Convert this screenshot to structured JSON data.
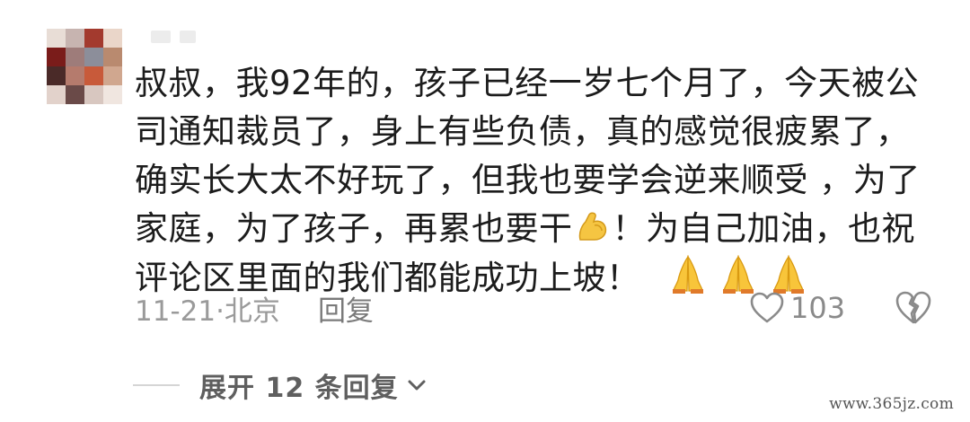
{
  "comment": {
    "lines": [
      "叔叔，我92年的，孩子已经一岁七个月了，今天被公",
      "司通知裁员了，身上有些负债，真的感觉很疲累了，",
      "确实长大太不好玩了，但我也要学会逆来顺受 ，为了",
      {
        "before": "家庭，为了孩子，再累也要干",
        "emoji": "flexed-biceps-emoji",
        "after": "！为自己加油，也祝"
      },
      {
        "before": "评论区里面的我们都能成功上坡！",
        "emoji": "folded-hands-emoji",
        "emoji_count": 3
      }
    ],
    "date_location": "11-21·北京",
    "reply_label": "回复",
    "like_count": "103",
    "expand_replies_label": "展开 12 条回复"
  },
  "icons": {
    "like": "heart-outline-icon",
    "dislike": "broken-heart-icon",
    "expand": "chevron-down-icon"
  },
  "colors": {
    "text": "#1c1c1c",
    "meta": "#9a9a9a",
    "background": "#ffffff"
  },
  "watermark": "www.365jz.com"
}
